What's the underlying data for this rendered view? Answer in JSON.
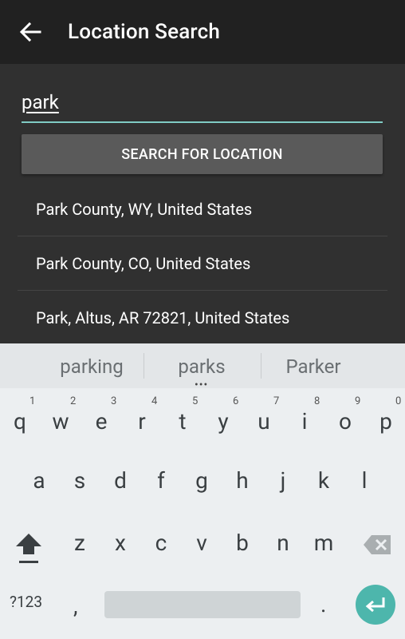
{
  "appbar": {
    "title": "Location Search"
  },
  "search": {
    "value": "park",
    "button_label": "SEARCH FOR LOCATION"
  },
  "results": [
    "Park County, WY, United States",
    "Park County, CO, United States",
    "Park, Altus, AR 72821, United States"
  ],
  "keyboard": {
    "suggestions": [
      "parking",
      "parks",
      "Parker"
    ],
    "row1": [
      "q",
      "w",
      "e",
      "r",
      "t",
      "y",
      "u",
      "i",
      "o",
      "p"
    ],
    "row1_hints": [
      "1",
      "2",
      "3",
      "4",
      "5",
      "6",
      "7",
      "8",
      "9",
      "0"
    ],
    "row2": [
      "a",
      "s",
      "d",
      "f",
      "g",
      "h",
      "j",
      "k",
      "l"
    ],
    "row3": [
      "z",
      "x",
      "c",
      "v",
      "b",
      "n",
      "m"
    ],
    "symbols_label": "?123",
    "comma": ",",
    "period": "."
  },
  "colors": {
    "accent": "#80cbc4",
    "enter": "#4db6ac",
    "appbar": "#212121"
  }
}
